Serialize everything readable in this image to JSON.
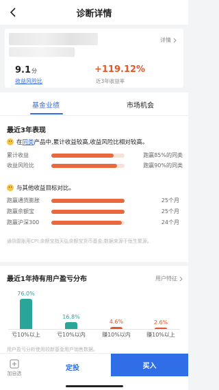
{
  "header": {
    "title": "诊断详情"
  },
  "fund": {
    "detail_link": "详情",
    "score": "9.1",
    "score_unit": "分",
    "score_label": "收益风险比",
    "return_value": "+119.12%",
    "return_label": "近3年收益率"
  },
  "tabs": [
    {
      "label": "基金业绩",
      "active": true
    },
    {
      "label": "市场机会",
      "active": false
    }
  ],
  "performance": {
    "title": "最近3年表现",
    "summary_prefix": "在",
    "summary_link": "同类",
    "summary_suffix": "产品中,累计收益较高,收益风险比相对较高。",
    "peer_bars": [
      {
        "label": "累计收益",
        "fill": 0.85,
        "value": "跑赢85%的同类"
      },
      {
        "label": "收益风险比",
        "fill": 0.9,
        "value": "跑赢90%的同类"
      }
    ],
    "compare_title": "与其他收益目标对比。",
    "compare_bars": [
      {
        "label": "跑赢通货膨胀",
        "fill": 1.0,
        "value": "25个月"
      },
      {
        "label": "跑赢余额宝",
        "fill": 1.0,
        "value": "25个月"
      },
      {
        "label": "跑赢沪深300",
        "fill": 0.96,
        "value": "24个月"
      }
    ],
    "footnote": "通货膨胀用CPI;余额宝指天弘余额宝货币基金;数据来源于恒生聚源。"
  },
  "distribution": {
    "title": "最近1年持有用户盈亏分布",
    "feature_link": "用户特征",
    "note": "用户盈亏分析使用较新基金用户销售数据。",
    "chart_data": {
      "type": "bar",
      "categories": [
        "亏10%以上",
        "亏10%以内",
        "赚10%以内",
        "赚10%以上"
      ],
      "values": [
        76.0,
        16.8,
        4.6,
        2.6
      ],
      "value_labels": [
        "76.0%",
        "16.8%",
        "4.6%",
        "2.6%"
      ],
      "colors": [
        "#2aa59a",
        "#2aa59a",
        "#e5572a",
        "#e5572a"
      ]
    }
  },
  "bottom": {
    "favorite_label": "加自选",
    "plan_label": "定投",
    "buy_label": "买入"
  },
  "colors": {
    "accent": "#2f6ee6",
    "gain": "#e5572a",
    "loss": "#2aa59a"
  }
}
